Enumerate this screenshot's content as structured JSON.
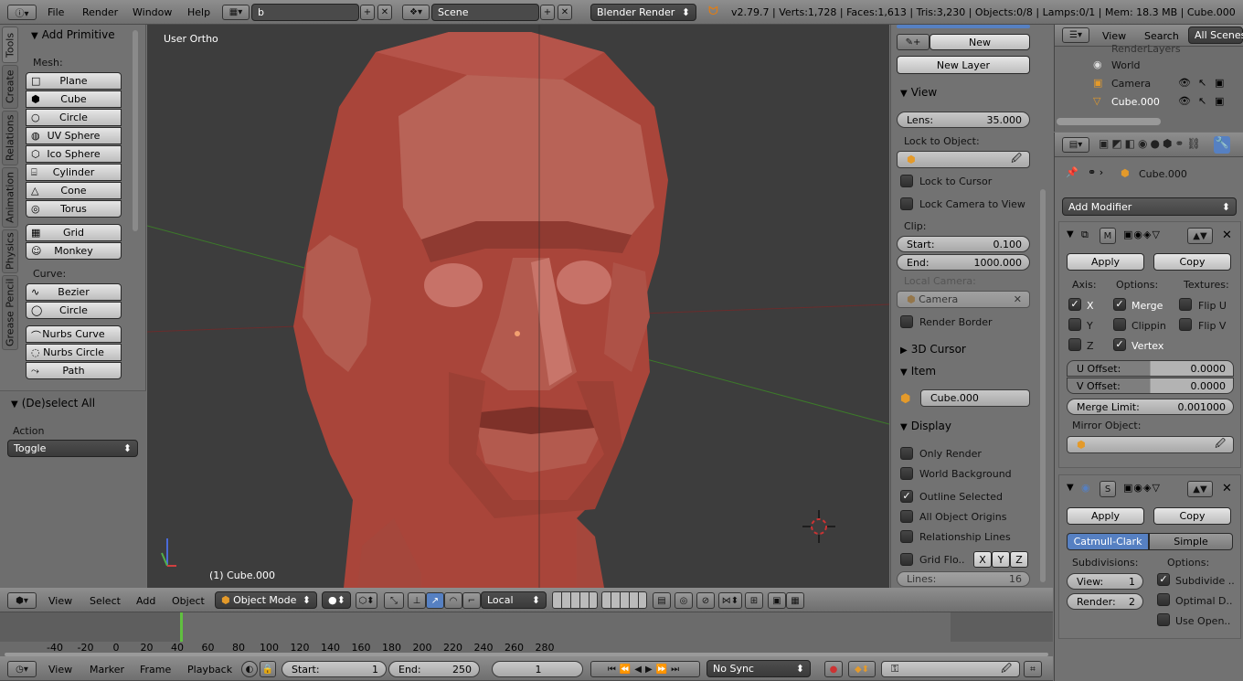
{
  "topbar": {
    "menus": [
      "File",
      "Render",
      "Window",
      "Help"
    ],
    "screen_layout": "b",
    "scene": "Scene",
    "engine": "Blender Render",
    "stats": "v2.79.7 | Verts:1,728 | Faces:1,613 | Tris:3,230 | Objects:0/8 | Lamps:0/1 | Mem: 18.3 MB | Cube.000"
  },
  "toolshelf": {
    "tabs": [
      "Tools",
      "Create",
      "Relations",
      "Animation",
      "Physics",
      "Grease Pencil"
    ],
    "add_primitive": "Add Primitive",
    "mesh_label": "Mesh:",
    "mesh": [
      {
        "label": "Plane",
        "icon": "plane-icon"
      },
      {
        "label": "Cube",
        "icon": "cube-icon"
      },
      {
        "label": "Circle",
        "icon": "circle-icon"
      },
      {
        "label": "UV Sphere",
        "icon": "uv-sphere-icon"
      },
      {
        "label": "Ico Sphere",
        "icon": "ico-sphere-icon"
      },
      {
        "label": "Cylinder",
        "icon": "cylinder-icon"
      },
      {
        "label": "Cone",
        "icon": "cone-icon"
      },
      {
        "label": "Torus",
        "icon": "torus-icon"
      }
    ],
    "mesh2": [
      {
        "label": "Grid",
        "icon": "grid-icon"
      },
      {
        "label": "Monkey",
        "icon": "monkey-icon"
      }
    ],
    "curve_label": "Curve:",
    "curve": [
      {
        "label": "Bezier",
        "icon": "bezier-icon"
      },
      {
        "label": "Circle",
        "icon": "curve-circle-icon"
      }
    ],
    "curve2": [
      {
        "label": "Nurbs Curve",
        "icon": "nurbs-curve-icon"
      },
      {
        "label": "Nurbs Circle",
        "icon": "nurbs-circle-icon"
      },
      {
        "label": "Path",
        "icon": "path-icon"
      }
    ],
    "operator": "(De)select All",
    "action_label": "Action",
    "action_value": "Toggle"
  },
  "viewport": {
    "view_label": "User Ortho",
    "object_label": "(1) Cube.000"
  },
  "npanel": {
    "new": "New",
    "new_layer": "New Layer",
    "view": "View",
    "lens_label": "Lens:",
    "lens_value": "35.000",
    "lock_to_object": "Lock to Object:",
    "lock_to_cursor": "Lock to Cursor",
    "lock_camera": "Lock Camera to View",
    "clip": "Clip:",
    "start_label": "Start:",
    "start_value": "0.100",
    "end_label": "End:",
    "end_value": "1000.000",
    "local_camera": "Local Camera:",
    "camera": "Camera",
    "render_border": "Render Border",
    "cursor": "3D Cursor",
    "item": "Item",
    "item_name": "Cube.000",
    "display": "Display",
    "only_render": "Only Render",
    "world_background": "World Background",
    "outline_selected": "Outline Selected",
    "all_origins": "All Object Origins",
    "relationship_lines": "Relationship Lines",
    "grid_floor": "Grid Flo..",
    "x": "X",
    "y": "Y",
    "z": "Z",
    "lines_label": "Lines:",
    "lines_value": "16"
  },
  "outliner": {
    "view": "View",
    "search": "Search",
    "all_scenes": "All Scenes",
    "items": [
      "RenderLayers",
      "World",
      "Camera",
      "Cube.000"
    ]
  },
  "properties": {
    "object": "Cube.000",
    "add_modifier": "Add Modifier",
    "apply": "Apply",
    "copy": "Copy",
    "axis": "Axis:",
    "options": "Options:",
    "textures": "Textures:",
    "x": "X",
    "y": "Y",
    "z": "Z",
    "merge": "Merge",
    "clipping": "Clippin",
    "vertex": "Vertex",
    "flip_u": "Flip U",
    "flip_v": "Flip V",
    "u_offset_label": "U Offset:",
    "u_offset": "0.0000",
    "v_offset_label": "V Offset:",
    "v_offset": "0.0000",
    "merge_limit_label": "Merge Limit:",
    "merge_limit": "0.001000",
    "mirror_object": "Mirror Object:",
    "catmull": "Catmull-Clark",
    "simple": "Simple",
    "subdivisions": "Subdivisions:",
    "options2": "Options:",
    "view_label": "View:",
    "view_val": "1",
    "render_label": "Render:",
    "render_val": "2",
    "subdivide": "Subdivide ..",
    "optimal": "Optimal D..",
    "use_open": "Use Open.."
  },
  "viewheader": {
    "menus": [
      "View",
      "Select",
      "Add",
      "Object"
    ],
    "mode": "Object Mode",
    "orientation": "Local"
  },
  "timeline": {
    "ticks": [
      "-40",
      "-20",
      "0",
      "20",
      "40",
      "60",
      "80",
      "100",
      "120",
      "140",
      "160",
      "180",
      "200",
      "220",
      "240",
      "260",
      "280"
    ],
    "menus": [
      "View",
      "Marker",
      "Frame",
      "Playback"
    ],
    "start_label": "Start:",
    "start": "1",
    "end_label": "End:",
    "end": "250",
    "current": "1",
    "sync": "No Sync"
  },
  "colors": {
    "accent": "#5680c2",
    "mesh": "#b0443a",
    "viewport": "#3d3d3d",
    "x_axis": "#8a2a2a",
    "y_axis": "#3d7a2a"
  }
}
